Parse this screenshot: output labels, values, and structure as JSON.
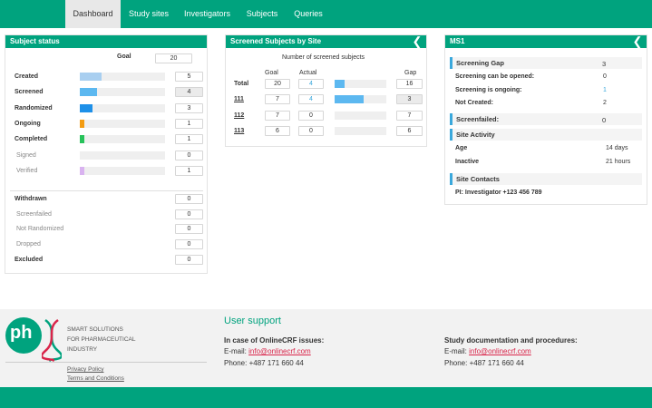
{
  "nav": {
    "items": [
      "Dashboard",
      "Study sites",
      "Investigators",
      "Subjects",
      "Queries"
    ],
    "active": "Dashboard"
  },
  "subject_status": {
    "title": "Subject status",
    "goal_label": "Goal",
    "goal_value": "20",
    "rows": [
      {
        "label": "Created",
        "value": "5",
        "fraction": 0.25,
        "color": "#a9cff0",
        "bold": true,
        "grey": false
      },
      {
        "label": "Screened",
        "value": "4",
        "fraction": 0.2,
        "color": "#5cb8f0",
        "bold": true,
        "grey": true
      },
      {
        "label": "Randomized",
        "value": "3",
        "fraction": 0.15,
        "color": "#1e90e8",
        "bold": true,
        "grey": false
      },
      {
        "label": "Ongoing",
        "value": "1",
        "fraction": 0.05,
        "color": "#f39c12",
        "bold": true,
        "grey": false
      },
      {
        "label": "Completed",
        "value": "1",
        "fraction": 0.05,
        "color": "#27c25a",
        "bold": true,
        "grey": false
      },
      {
        "label": "Signed",
        "value": "0",
        "fraction": 0,
        "color": "#cccccc",
        "bold": false,
        "grey": false
      },
      {
        "label": "Verified",
        "value": "1",
        "fraction": 0.05,
        "color": "#d9b3f0",
        "bold": false,
        "grey": false
      }
    ],
    "other_rows": [
      {
        "label": "Withdrawn",
        "value": "0",
        "bold": true
      },
      {
        "label": "Screenfailed",
        "value": "0",
        "bold": false
      },
      {
        "label": "Not Randomized",
        "value": "0",
        "bold": false
      },
      {
        "label": "Dropped",
        "value": "0",
        "bold": false
      },
      {
        "label": "Excluded",
        "value": "0",
        "bold": true
      }
    ]
  },
  "screened_by_site": {
    "title": "Screened Subjects by Site",
    "subtitle": "Number of screened subjects",
    "col_goal": "Goal",
    "col_actual": "Actual",
    "col_gap": "Gap",
    "rows": [
      {
        "site": "Total",
        "goal": "20",
        "actual": "4",
        "fraction": 0.2,
        "gap": "16",
        "link": false,
        "actual_blue": true,
        "gap_grey": false
      },
      {
        "site": "111",
        "goal": "7",
        "actual": "4",
        "fraction": 0.57,
        "gap": "3",
        "link": true,
        "actual_blue": true,
        "gap_grey": true
      },
      {
        "site": "112",
        "goal": "7",
        "actual": "0",
        "fraction": 0,
        "gap": "7",
        "link": true,
        "actual_blue": false,
        "gap_grey": false
      },
      {
        "site": "113",
        "goal": "6",
        "actual": "0",
        "fraction": 0,
        "gap": "6",
        "link": true,
        "actual_blue": false,
        "gap_grey": false
      }
    ]
  },
  "ms1": {
    "title": "MS1",
    "screening_gap_label": "Screening Gap",
    "screening_gap_value": "3",
    "screening_items": [
      {
        "label": "Screening can be opened:",
        "value": "0",
        "blue": false
      },
      {
        "label": "Screening is ongoing:",
        "value": "1",
        "blue": true
      },
      {
        "label": "Not Created:",
        "value": "2",
        "blue": false
      }
    ],
    "screenfailed_label": "Screenfailed:",
    "screenfailed_value": "0",
    "site_activity_label": "Site Activity",
    "age_label": "Age",
    "age_value": "14 days",
    "inactive_label": "Inactive",
    "inactive_value": "21 hours",
    "contacts_label": "Site Contacts",
    "contact_text": "PI: Investigator +123 456 789"
  },
  "footer": {
    "logo_text": "ph",
    "tagline": [
      "SMART SOLUTIONS",
      "FOR PHARMACEUTICAL",
      "INDUSTRY"
    ],
    "privacy": "Privacy Policy",
    "terms": "Terms and Conditions",
    "support_title": "User support",
    "issues_title": "In case of OnlineCRF issues:",
    "email_label": "E-mail:",
    "email": "info@onlinecrf.com",
    "phone": "Phone: +487 171 660 44",
    "docs_title": "Study documentation and procedures:",
    "docs_email": "info@onlinecrf.com",
    "docs_phone": "Phone: +487 171 660 44"
  }
}
